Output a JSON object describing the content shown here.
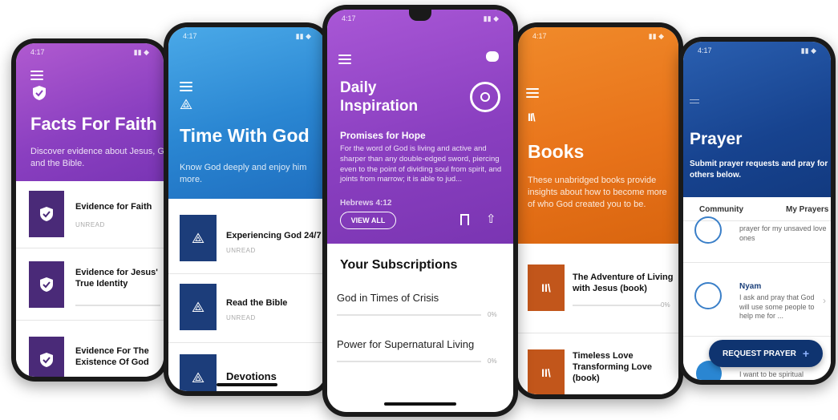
{
  "status_time": "4:17",
  "facts": {
    "title": "Facts For Faith",
    "subtitle": "Discover evidence about Jesus, God and the Bible.",
    "items": [
      {
        "title": "Evidence for Faith",
        "status": "UNREAD"
      },
      {
        "title": "Evidence for Jesus' True Identity",
        "status": ""
      },
      {
        "title": "Evidence For The Existence Of God",
        "status": ""
      }
    ]
  },
  "time_with_god": {
    "title": "Time With God",
    "subtitle": "Know God deeply and enjoy him more.",
    "items": [
      {
        "title": "Experiencing God 24/7",
        "status": "UNREAD"
      },
      {
        "title": "Read the Bible",
        "status": "UNREAD"
      },
      {
        "title": "Devotions",
        "status": ""
      }
    ]
  },
  "daily": {
    "title": "Daily Inspiration",
    "heading": "Promises for Hope",
    "verse": "For the word of God is living and active and sharper than any double-edged sword, piercing even to the point of dividing soul from spirit, and joints from marrow; it is able to jud...",
    "reference": "Hebrews 4:12",
    "view_all": "VIEW ALL",
    "subs_title": "Your Subscriptions",
    "subscriptions": [
      {
        "title": "God in Times of Crisis",
        "progress": "0%"
      },
      {
        "title": "Power for Supernatural Living",
        "progress": "0%"
      }
    ]
  },
  "books": {
    "title": "Books",
    "subtitle": "These unabridged books provide insights about how to become more of who God created you to be.",
    "items": [
      {
        "title": "The Adventure of Living with Jesus (book)",
        "progress": "0%"
      },
      {
        "title": "Timeless Love Transforming Love (book)",
        "progress": ""
      }
    ]
  },
  "prayer": {
    "title": "Prayer",
    "subtitle": "Submit prayer requests and pray for others below.",
    "tabs": [
      "Community",
      "My Prayers"
    ],
    "items": [
      {
        "name": "",
        "text": "prayer for my unsaved love ones"
      },
      {
        "name": "Nyam",
        "text": "I ask and pray that God will use some people to help me for ..."
      },
      {
        "name": "",
        "text": "I want to be spiritual"
      }
    ],
    "request_button": "REQUEST PRAYER",
    "plus": "+"
  },
  "colors": {
    "purple": "#8a3fc0",
    "blue": "#1f7fcf",
    "orange": "#e8731a",
    "navy": "#17438f",
    "tile_purple": "#4a2a78",
    "tile_navy": "#1c3d7a",
    "tile_orange": "#c2561b"
  }
}
